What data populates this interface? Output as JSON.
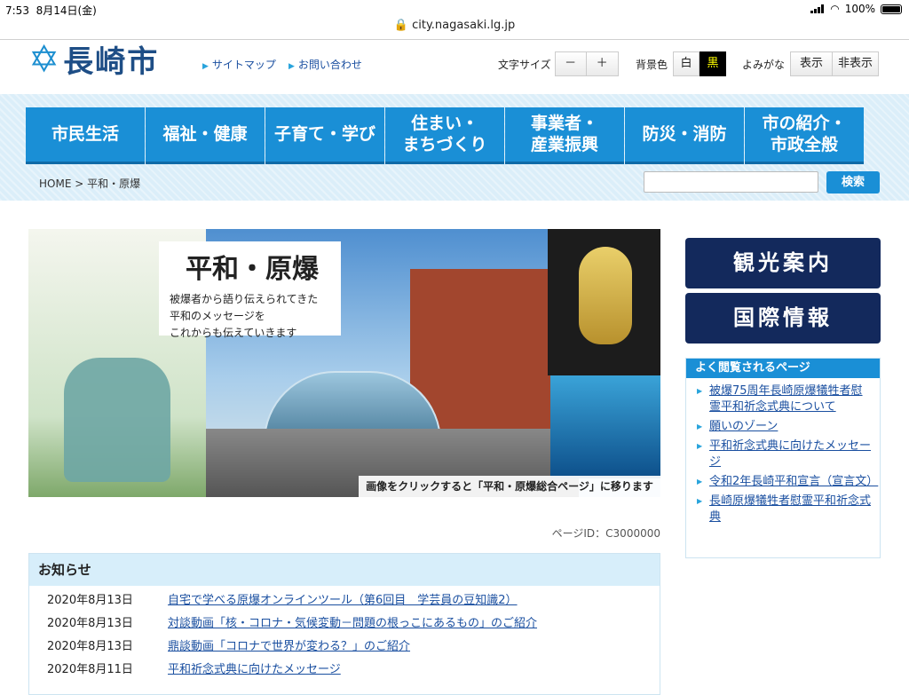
{
  "status_bar": {
    "time": "7:53",
    "date": "8月14日(金)",
    "battery": "100%",
    "url": "city.nagasaki.lg.jp"
  },
  "header": {
    "logo_text": "長崎市",
    "links": [
      "サイトマップ",
      "お問い合わせ"
    ],
    "font_size_label": "文字サイズ",
    "font_minus": "－",
    "font_plus": "＋",
    "bg_label": "背景色",
    "bg_white": "白",
    "bg_black": "黒",
    "furigana_label": "よみがな",
    "furigana_show": "表示",
    "furigana_hide": "非表示"
  },
  "nav": [
    "市民生活",
    "福祉・健康",
    "子育て・学び",
    "住まい・\nまちづくり",
    "事業者・\n産業振興",
    "防災・消防",
    "市の紹介・\n市政全般"
  ],
  "breadcrumb": {
    "home": "HOME",
    "sep": " > ",
    "current": "平和・原爆"
  },
  "search": {
    "button": "検索",
    "placeholder": ""
  },
  "hero": {
    "title": "平和・原爆",
    "subtitle_lines": [
      "被爆者から語り伝えられてきた",
      "平和のメッセージを",
      "これからも伝えていきます"
    ],
    "caption": "画像をクリックすると「平和・原爆総合ページ」に移ります"
  },
  "page_id": "ページID：C3000000",
  "notice": {
    "heading": "お知らせ",
    "items": [
      {
        "date": "2020年8月13日",
        "text": "自宅で学べる原爆オンラインツール（第6回目　学芸員の豆知識2）"
      },
      {
        "date": "2020年8月13日",
        "text": "対談動画「核・コロナ・気候変動－問題の根っこにあるもの」のご紹介"
      },
      {
        "date": "2020年8月13日",
        "text": "鼎談動画「コロナで世界が変わる？」のご紹介"
      },
      {
        "date": "2020年8月11日",
        "text": "平和祈念式典に向けたメッセージ"
      }
    ]
  },
  "side": {
    "tourism": "観光案内",
    "international": "国際情報",
    "popular_heading": "よく閲覧されるページ",
    "popular": [
      "被爆75周年長崎原爆犠牲者慰霊平和祈念式典について",
      "願いのゾーン",
      "平和祈念式典に向けたメッセージ",
      "令和2年長崎平和宣言（宣言文）",
      "長崎原爆犠牲者慰霊平和祈念式典"
    ]
  },
  "colors": {
    "nav_blue": "#1a8fd6",
    "side_navy": "#13295c",
    "band": "#dbeef9"
  }
}
